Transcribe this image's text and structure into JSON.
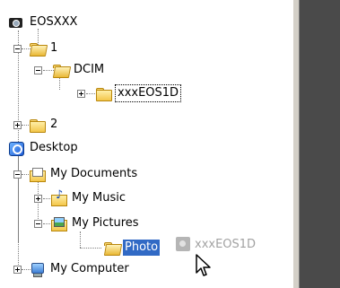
{
  "tree": {
    "eosxxx": "EOSXXX",
    "folder_1": "1",
    "dcim": "DCIM",
    "xxxeos1d": "xxxEOS1D",
    "folder_2": "2",
    "desktop": "Desktop",
    "my_documents": "My Documents",
    "my_music": "My Music",
    "my_pictures": "My Pictures",
    "photo": "Photo",
    "my_computer": "My Computer"
  },
  "drag": {
    "ghost_label": "xxxEOS1D"
  },
  "colors": {
    "selection": "#316ac5",
    "side_pane": "#4a4a4a"
  }
}
